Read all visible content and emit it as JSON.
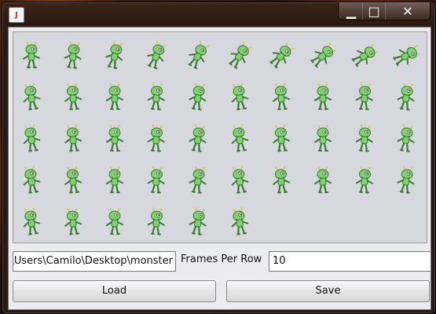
{
  "window": {
    "icon_label": "J",
    "controls": {
      "minimize": "▁",
      "maximize": "□",
      "close": "✕"
    }
  },
  "sprites": {
    "rows": [
      10,
      10,
      10,
      10,
      6
    ],
    "body_color": "#7ed36f",
    "outline_color": "#3a7a34",
    "accent_color": "#c9d15a"
  },
  "form": {
    "path_value": "C:\\Users\\Camilo\\Desktop\\monster",
    "frames_label": "Frames Per Row",
    "frames_value": "10"
  },
  "buttons": {
    "load_label": "Load",
    "save_label": "Save"
  }
}
